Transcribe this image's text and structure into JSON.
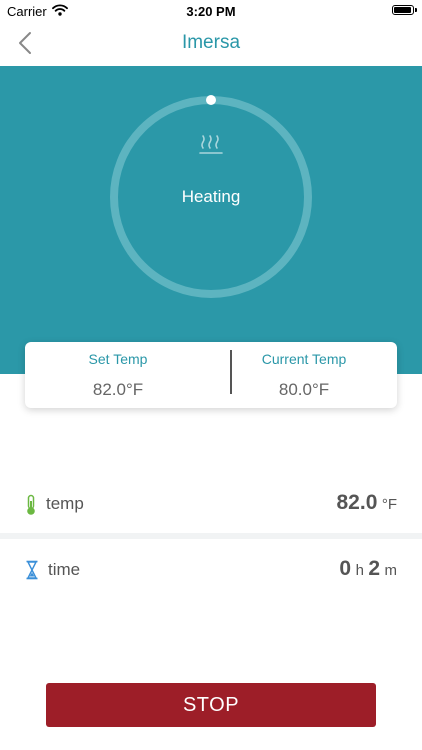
{
  "status_bar": {
    "carrier": "Carrier",
    "time": "3:20 PM"
  },
  "nav": {
    "title": "Imersa",
    "back_icon": "chevron-left-icon"
  },
  "hero": {
    "status": "Heating",
    "status_icon": "heat-waves-icon",
    "background_color": "#2b98a8"
  },
  "temp_card": {
    "set_label": "Set Temp",
    "set_value": "82.0°F",
    "current_label": "Current Temp",
    "current_value": "80.0°F"
  },
  "rows": {
    "temp": {
      "label": "temp",
      "value": "82.0",
      "unit": "°F",
      "icon": "thermometer-icon"
    },
    "time": {
      "label": "time",
      "hours": "0",
      "hours_unit": "h",
      "minutes": "2",
      "minutes_unit": "m",
      "icon": "hourglass-icon"
    }
  },
  "stop_button": {
    "label": "STOP",
    "color": "#9d1e28"
  }
}
